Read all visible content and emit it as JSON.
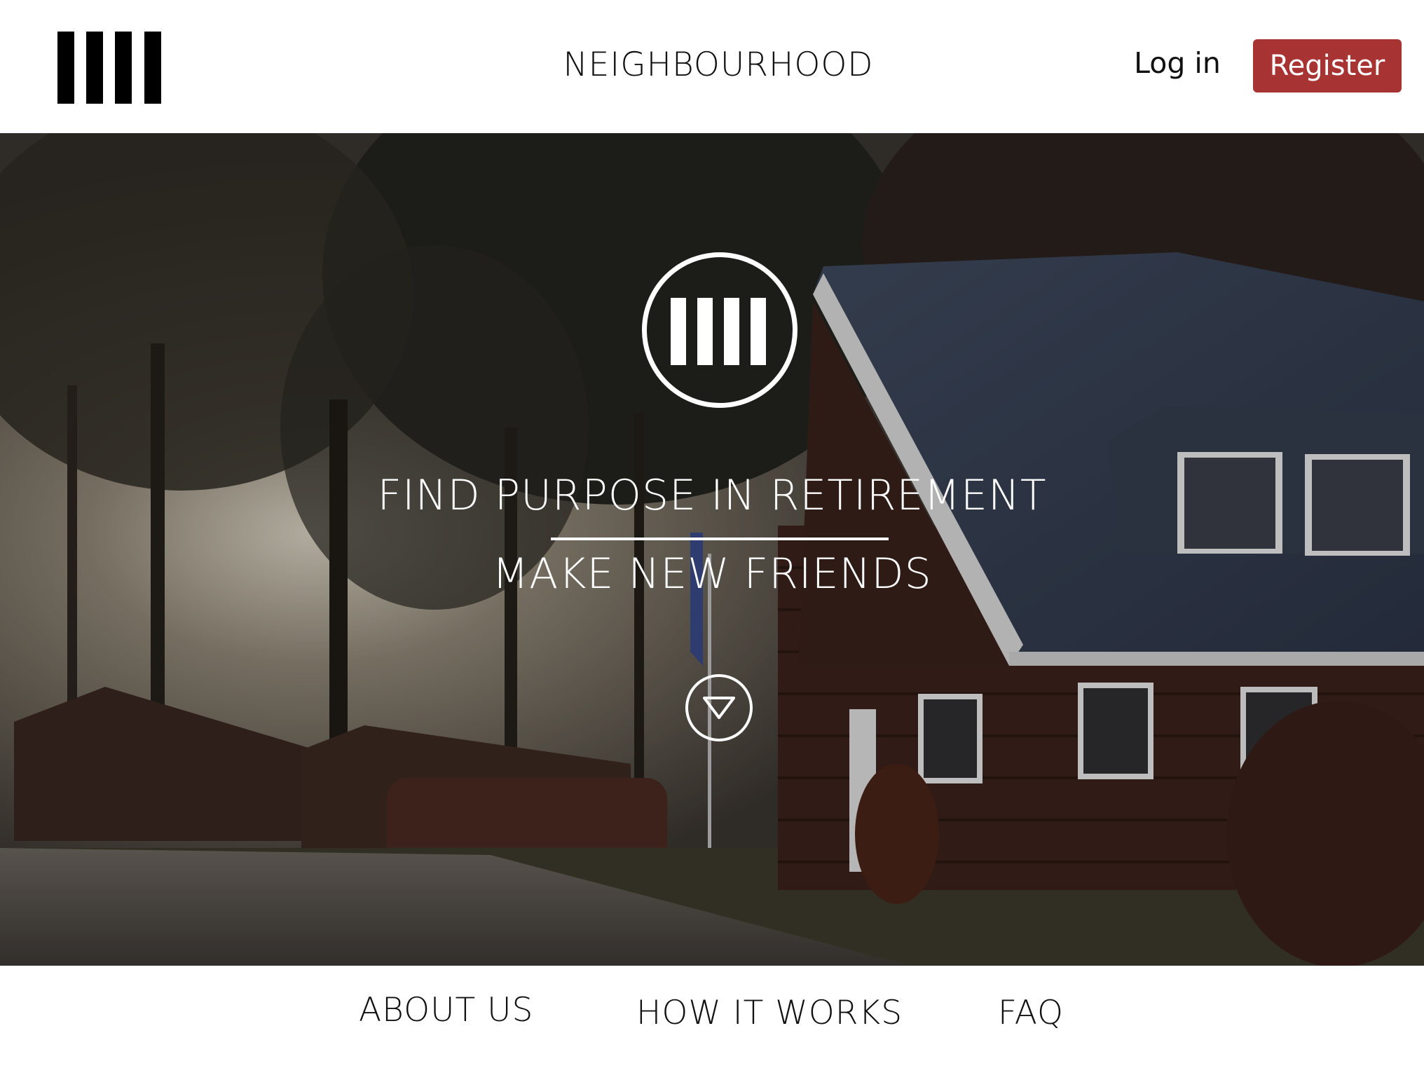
{
  "header": {
    "logo_icon": "four-bars-logo-icon",
    "site_title": "NEIGHBOURHOOD",
    "login_label": "Log in",
    "register_label": "Register"
  },
  "hero": {
    "logo_icon": "four-bars-circle-logo-icon",
    "headline": "FIND PURPOSE IN RETIREMENT",
    "subheadline": "MAKE NEW FRIENDS",
    "scroll_icon": "chevron-down-circle-icon"
  },
  "bottom_nav": {
    "items": [
      {
        "label": "ABOUT US"
      },
      {
        "label": "HOW IT WORKS"
      },
      {
        "label": "FAQ"
      }
    ]
  },
  "colors": {
    "accent": "#a83333",
    "text": "#111111",
    "background": "#ffffff"
  }
}
